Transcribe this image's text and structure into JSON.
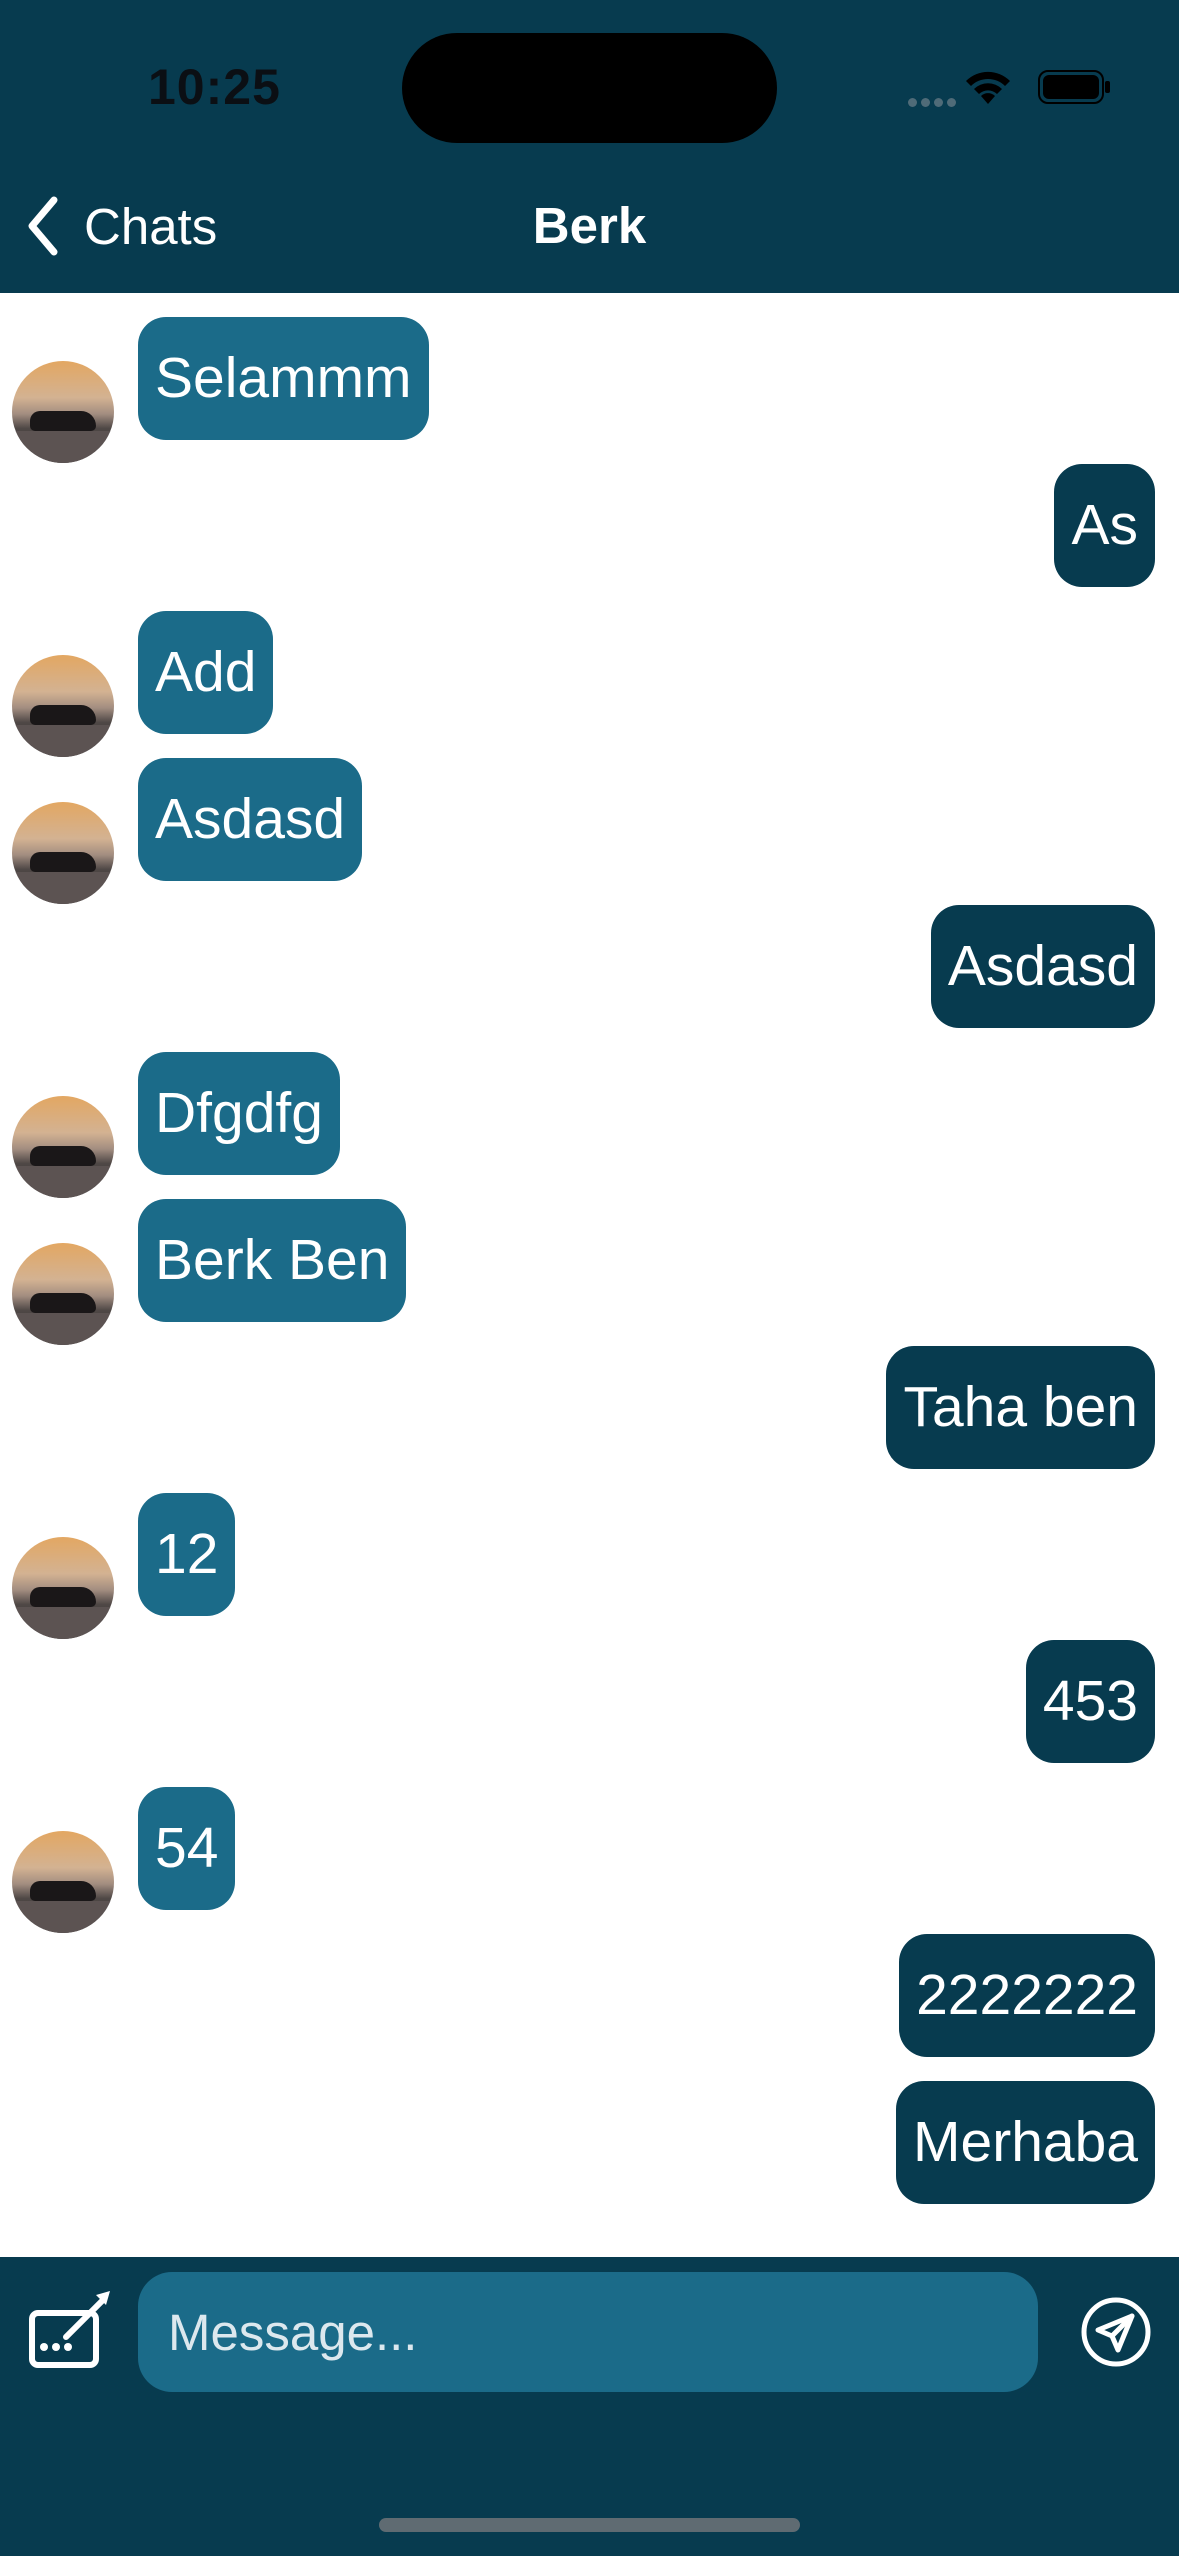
{
  "status_bar": {
    "time": "10:25"
  },
  "nav": {
    "back_label": "Chats",
    "title": "Berk"
  },
  "messages": [
    {
      "text": "Selammm",
      "direction": "in"
    },
    {
      "text": "As",
      "direction": "out"
    },
    {
      "text": "Add",
      "direction": "in"
    },
    {
      "text": "Asdasd",
      "direction": "in"
    },
    {
      "text": "Asdasd",
      "direction": "out"
    },
    {
      "text": "Dfgdfg",
      "direction": "in"
    },
    {
      "text": "Berk Ben",
      "direction": "in"
    },
    {
      "text": "Taha ben",
      "direction": "out"
    },
    {
      "text": "12",
      "direction": "in"
    },
    {
      "text": "453",
      "direction": "out"
    },
    {
      "text": "54",
      "direction": "in"
    },
    {
      "text": "2222222",
      "direction": "out"
    },
    {
      "text": "Merhaba",
      "direction": "out"
    }
  ],
  "composer": {
    "placeholder": "Message..."
  },
  "colors": {
    "header": "#073b4f",
    "incoming_bubble": "#1b6b89",
    "outgoing_bubble": "#073b4f",
    "input": "#1b6b89"
  }
}
